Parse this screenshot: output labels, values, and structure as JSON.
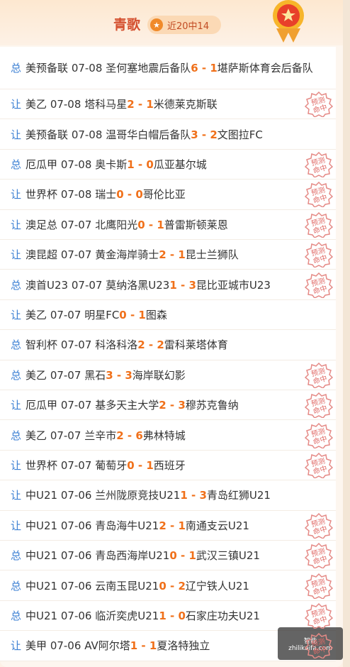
{
  "header": {
    "title": "青歌",
    "badge": "近20中14"
  },
  "rows": [
    {
      "type": "总",
      "league": "美预备联",
      "date": "07-08",
      "home": "圣何塞地震后备队",
      "hs": "6",
      "as": "1",
      "away": "堪萨斯体育会后备队",
      "hit": false
    },
    {
      "type": "让",
      "league": "美乙",
      "date": "07-08",
      "home": "塔科马星",
      "hs": "2",
      "as": "1",
      "away": "米德莱克斯联",
      "hit": true
    },
    {
      "type": "让",
      "league": "美预备联",
      "date": "07-08",
      "home": "温哥华白帽后备队",
      "hs": "3",
      "as": "2",
      "away": "文图拉FC",
      "hit": false
    },
    {
      "type": "总",
      "league": "厄瓜甲",
      "date": "07-08",
      "home": "奥卡斯",
      "hs": "1",
      "as": "0",
      "away": "瓜亚基尔城",
      "hit": true
    },
    {
      "type": "让",
      "league": "世界杯",
      "date": "07-08",
      "home": "瑞士",
      "hs": "0",
      "as": "0",
      "away": "哥伦比亚",
      "hit": true
    },
    {
      "type": "让",
      "league": "澳足总",
      "date": "07-07",
      "home": "北鹰阳光",
      "hs": "0",
      "as": "1",
      "away": "普雷斯顿莱恩",
      "hit": true
    },
    {
      "type": "让",
      "league": "澳昆超",
      "date": "07-07",
      "home": "黄金海岸骑士",
      "hs": "2",
      "as": "1",
      "away": "昆士兰狮队",
      "hit": true
    },
    {
      "type": "总",
      "league": "澳首U23",
      "date": "07-07",
      "home": "莫纳洛黑U23",
      "hs": "1",
      "as": "3",
      "away": "昆比亚城市U23",
      "hit": true
    },
    {
      "type": "让",
      "league": "美乙",
      "date": "07-07",
      "home": "明星FC",
      "hs": "0",
      "as": "1",
      "away": "图森",
      "hit": false
    },
    {
      "type": "总",
      "league": "智利杯",
      "date": "07-07",
      "home": "科洛科洛",
      "hs": "2",
      "as": "2",
      "away": "雷科莱塔体育",
      "hit": false
    },
    {
      "type": "总",
      "league": "美乙",
      "date": "07-07",
      "home": "黑石",
      "hs": "3",
      "as": "3",
      "away": "海岸联幻影",
      "hit": true
    },
    {
      "type": "让",
      "league": "厄瓜甲",
      "date": "07-07",
      "home": "基多天主大学",
      "hs": "2",
      "as": "3",
      "away": "穆苏克鲁纳",
      "hit": true
    },
    {
      "type": "总",
      "league": "美乙",
      "date": "07-07",
      "home": "兰辛市",
      "hs": "2",
      "as": "6",
      "away": "弗林特城",
      "hit": true
    },
    {
      "type": "让",
      "league": "世界杯",
      "date": "07-07",
      "home": "葡萄牙",
      "hs": "0",
      "as": "1",
      "away": "西班牙",
      "hit": true
    },
    {
      "type": "让",
      "league": "中U21",
      "date": "07-06",
      "home": "兰州陇原竞技U21",
      "hs": "1",
      "as": "3",
      "away": "青岛红狮U21",
      "hit": false
    },
    {
      "type": "让",
      "league": "中U21",
      "date": "07-06",
      "home": "青岛海牛U21",
      "hs": "2",
      "as": "1",
      "away": "南通支云U21",
      "hit": true
    },
    {
      "type": "总",
      "league": "中U21",
      "date": "07-06",
      "home": "青岛西海岸U21",
      "hs": "0",
      "as": "1",
      "away": "武汉三镇U21",
      "hit": true
    },
    {
      "type": "总",
      "league": "中U21",
      "date": "07-06",
      "home": "云南玉昆U21",
      "hs": "0",
      "as": "2",
      "away": "辽宁铁人U21",
      "hit": true
    },
    {
      "type": "总",
      "league": "中U21",
      "date": "07-06",
      "home": "临沂奕虎U21",
      "hs": "1",
      "as": "0",
      "away": "石家庄功夫U21",
      "hit": true
    },
    {
      "type": "让",
      "league": "美甲",
      "date": "07-06",
      "home": "AV阿尔塔",
      "hs": "1",
      "as": "1",
      "away": "夏洛特独立",
      "hit": true
    }
  ],
  "stamp_text": [
    "预测",
    "命中"
  ],
  "watermark": {
    "line1": "智能",
    "line2": "zhilikaifa.com"
  },
  "colors": {
    "accent": "#f0701a",
    "type": "#3b7fd3",
    "title": "#d4502f"
  }
}
